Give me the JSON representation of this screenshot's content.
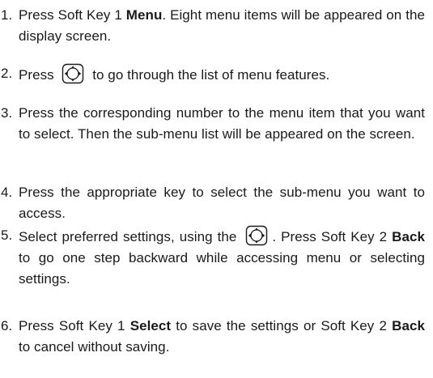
{
  "steps": [
    {
      "num": "1.",
      "parts": [
        "Press Soft Key 1 ",
        "Menu",
        ". Eight menu items will be appeared on the display screen."
      ]
    },
    {
      "num": "2.",
      "parts": [
        "Press ",
        " to go through the list of menu features."
      ],
      "icon": "navigation-key-icon"
    },
    {
      "num": "3.",
      "text": "Press the corresponding number to the menu item that you want to select. Then the sub-menu list will be appeared on the screen."
    },
    {
      "num": "4.",
      "text": "Press the appropriate key to select the sub-menu you want to access."
    },
    {
      "num": "5.",
      "parts": [
        "Select preferred settings, using the ",
        ". Press Soft Key 2 ",
        "Back",
        " to go one step backward while accessing menu or selecting settings."
      ],
      "icon": "navigation-key-icon"
    },
    {
      "num": "6.",
      "parts": [
        "Press Soft Key 1 ",
        "Select",
        " to save the settings or Soft Key 2 ",
        "Back",
        " to cancel without saving."
      ]
    }
  ],
  "colors": {
    "text": "#1a1a1a",
    "background": "#ffffff"
  }
}
